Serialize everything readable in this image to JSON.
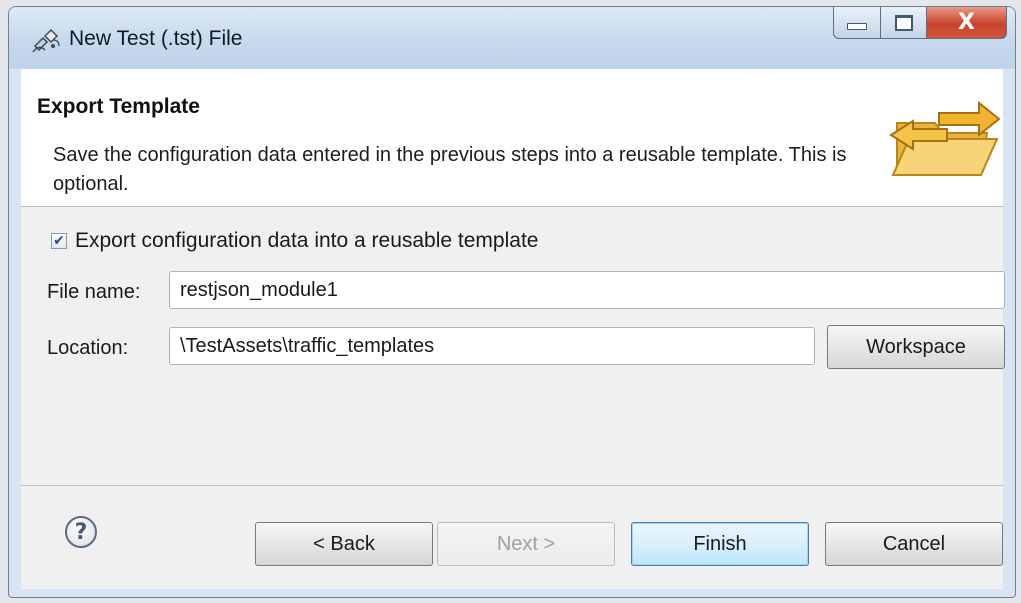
{
  "window": {
    "title": "New Test (.tst) File",
    "controls": {
      "close_glyph": "X"
    }
  },
  "header": {
    "title": "Export Template",
    "description": "Save the configuration data entered in the previous steps into a reusable template. This is optional.",
    "icon": "folder-transfer-icon"
  },
  "form": {
    "export_checkbox": {
      "label": "Export configuration data into a reusable template",
      "checked": true
    },
    "file_name": {
      "label": "File name:",
      "value": "restjson_module1"
    },
    "location": {
      "label": "Location:",
      "value": "\\TestAssets\\traffic_templates"
    },
    "workspace_button": "Workspace"
  },
  "footer": {
    "help_glyph": "?",
    "back": "< Back",
    "next": "Next >",
    "finish": "Finish",
    "cancel": "Cancel"
  },
  "colors": {
    "titlebar": "#c6d8ec",
    "close_button": "#c8442c",
    "default_button_border": "#3c7fb1",
    "folder": "#f2c14e",
    "arrow": "#e9a321"
  }
}
